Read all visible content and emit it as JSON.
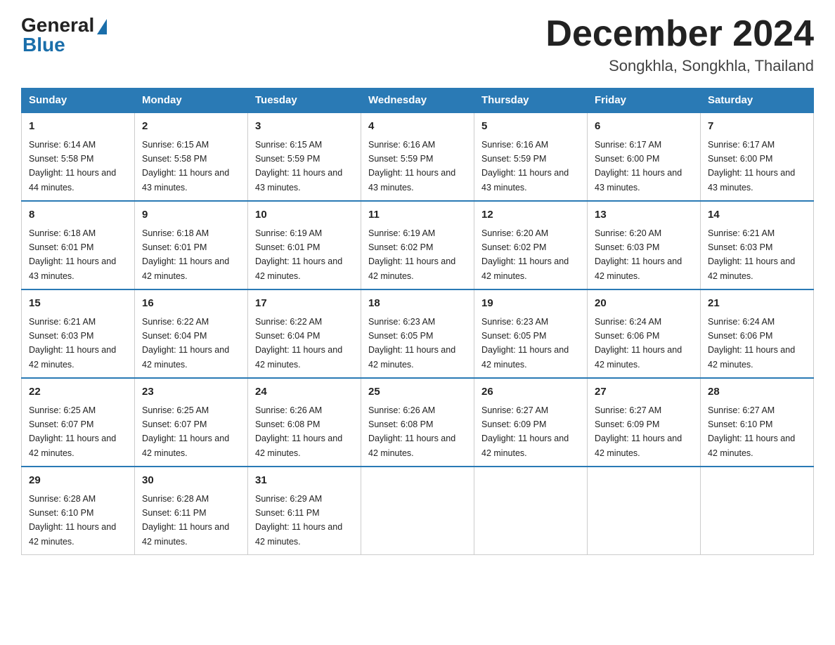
{
  "logo": {
    "general": "General",
    "blue": "Blue"
  },
  "title": "December 2024",
  "location": "Songkhla, Songkhla, Thailand",
  "days_of_week": [
    "Sunday",
    "Monday",
    "Tuesday",
    "Wednesday",
    "Thursday",
    "Friday",
    "Saturday"
  ],
  "weeks": [
    [
      {
        "day": "1",
        "sunrise": "6:14 AM",
        "sunset": "5:58 PM",
        "daylight": "11 hours and 44 minutes."
      },
      {
        "day": "2",
        "sunrise": "6:15 AM",
        "sunset": "5:58 PM",
        "daylight": "11 hours and 43 minutes."
      },
      {
        "day": "3",
        "sunrise": "6:15 AM",
        "sunset": "5:59 PM",
        "daylight": "11 hours and 43 minutes."
      },
      {
        "day": "4",
        "sunrise": "6:16 AM",
        "sunset": "5:59 PM",
        "daylight": "11 hours and 43 minutes."
      },
      {
        "day": "5",
        "sunrise": "6:16 AM",
        "sunset": "5:59 PM",
        "daylight": "11 hours and 43 minutes."
      },
      {
        "day": "6",
        "sunrise": "6:17 AM",
        "sunset": "6:00 PM",
        "daylight": "11 hours and 43 minutes."
      },
      {
        "day": "7",
        "sunrise": "6:17 AM",
        "sunset": "6:00 PM",
        "daylight": "11 hours and 43 minutes."
      }
    ],
    [
      {
        "day": "8",
        "sunrise": "6:18 AM",
        "sunset": "6:01 PM",
        "daylight": "11 hours and 43 minutes."
      },
      {
        "day": "9",
        "sunrise": "6:18 AM",
        "sunset": "6:01 PM",
        "daylight": "11 hours and 42 minutes."
      },
      {
        "day": "10",
        "sunrise": "6:19 AM",
        "sunset": "6:01 PM",
        "daylight": "11 hours and 42 minutes."
      },
      {
        "day": "11",
        "sunrise": "6:19 AM",
        "sunset": "6:02 PM",
        "daylight": "11 hours and 42 minutes."
      },
      {
        "day": "12",
        "sunrise": "6:20 AM",
        "sunset": "6:02 PM",
        "daylight": "11 hours and 42 minutes."
      },
      {
        "day": "13",
        "sunrise": "6:20 AM",
        "sunset": "6:03 PM",
        "daylight": "11 hours and 42 minutes."
      },
      {
        "day": "14",
        "sunrise": "6:21 AM",
        "sunset": "6:03 PM",
        "daylight": "11 hours and 42 minutes."
      }
    ],
    [
      {
        "day": "15",
        "sunrise": "6:21 AM",
        "sunset": "6:03 PM",
        "daylight": "11 hours and 42 minutes."
      },
      {
        "day": "16",
        "sunrise": "6:22 AM",
        "sunset": "6:04 PM",
        "daylight": "11 hours and 42 minutes."
      },
      {
        "day": "17",
        "sunrise": "6:22 AM",
        "sunset": "6:04 PM",
        "daylight": "11 hours and 42 minutes."
      },
      {
        "day": "18",
        "sunrise": "6:23 AM",
        "sunset": "6:05 PM",
        "daylight": "11 hours and 42 minutes."
      },
      {
        "day": "19",
        "sunrise": "6:23 AM",
        "sunset": "6:05 PM",
        "daylight": "11 hours and 42 minutes."
      },
      {
        "day": "20",
        "sunrise": "6:24 AM",
        "sunset": "6:06 PM",
        "daylight": "11 hours and 42 minutes."
      },
      {
        "day": "21",
        "sunrise": "6:24 AM",
        "sunset": "6:06 PM",
        "daylight": "11 hours and 42 minutes."
      }
    ],
    [
      {
        "day": "22",
        "sunrise": "6:25 AM",
        "sunset": "6:07 PM",
        "daylight": "11 hours and 42 minutes."
      },
      {
        "day": "23",
        "sunrise": "6:25 AM",
        "sunset": "6:07 PM",
        "daylight": "11 hours and 42 minutes."
      },
      {
        "day": "24",
        "sunrise": "6:26 AM",
        "sunset": "6:08 PM",
        "daylight": "11 hours and 42 minutes."
      },
      {
        "day": "25",
        "sunrise": "6:26 AM",
        "sunset": "6:08 PM",
        "daylight": "11 hours and 42 minutes."
      },
      {
        "day": "26",
        "sunrise": "6:27 AM",
        "sunset": "6:09 PM",
        "daylight": "11 hours and 42 minutes."
      },
      {
        "day": "27",
        "sunrise": "6:27 AM",
        "sunset": "6:09 PM",
        "daylight": "11 hours and 42 minutes."
      },
      {
        "day": "28",
        "sunrise": "6:27 AM",
        "sunset": "6:10 PM",
        "daylight": "11 hours and 42 minutes."
      }
    ],
    [
      {
        "day": "29",
        "sunrise": "6:28 AM",
        "sunset": "6:10 PM",
        "daylight": "11 hours and 42 minutes."
      },
      {
        "day": "30",
        "sunrise": "6:28 AM",
        "sunset": "6:11 PM",
        "daylight": "11 hours and 42 minutes."
      },
      {
        "day": "31",
        "sunrise": "6:29 AM",
        "sunset": "6:11 PM",
        "daylight": "11 hours and 42 minutes."
      },
      null,
      null,
      null,
      null
    ]
  ]
}
